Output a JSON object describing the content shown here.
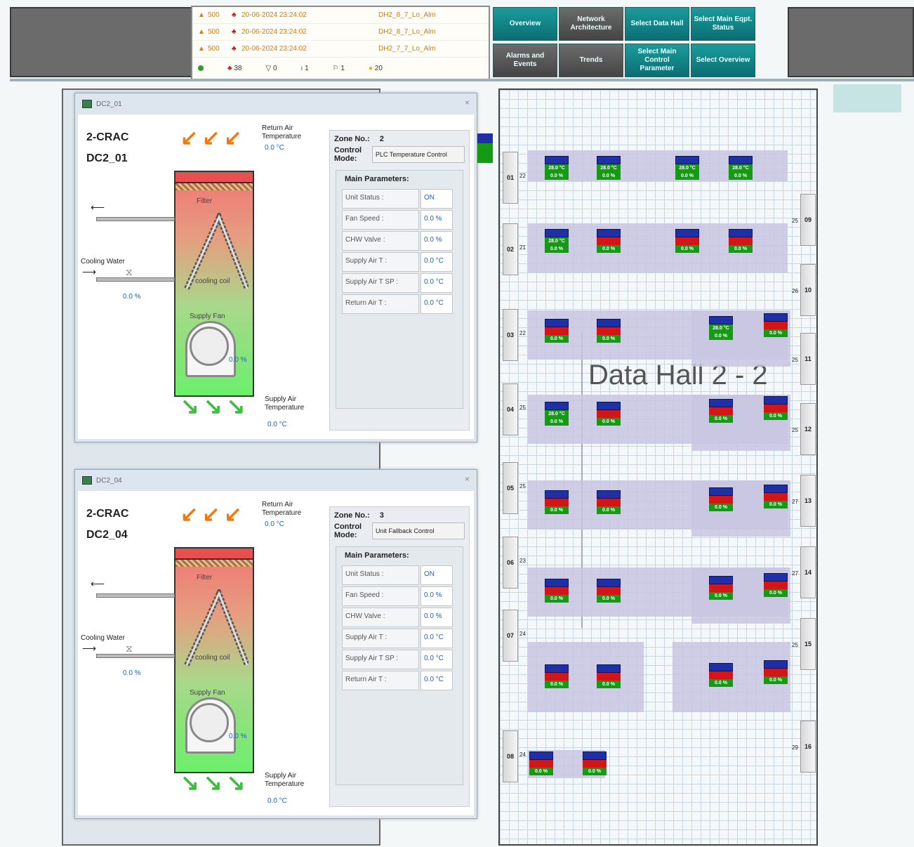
{
  "alarms": {
    "rows": [
      {
        "priority": "500",
        "timestamp": "20-06-2024 23:24:02",
        "tag": "DH2_8_7_Lo_Alm"
      },
      {
        "priority": "500",
        "timestamp": "20-06-2024 23:24:02",
        "tag": "DH2_8_7_Lo_Alm"
      },
      {
        "priority": "500",
        "timestamp": "20-06-2024 23:24:02",
        "tag": "DH2_7_7_Lo_Alm"
      }
    ],
    "summary": [
      "38",
      "0",
      "1",
      "1",
      "20"
    ]
  },
  "nav": {
    "overview": "Overview",
    "network": "Network Architecture",
    "select_data_hall": "Select Data Hall",
    "select_main_eqpt": "Select Main Eqpt. Status",
    "alarms_events": "Alarms and Events",
    "trends": "Trends",
    "select_main_control": "Select Main Control Parameter",
    "select_overview": "Select Overview"
  },
  "crac_windows": [
    {
      "window_title": "DC2_01",
      "name_line1": "2-CRAC",
      "name_line2": "DC2_01",
      "return_air_label": "Return Air Temperature",
      "return_air_value": "0.0 °C",
      "filter_label": "Filter",
      "coil_label": "cooling coil",
      "fan_label": "Supply Fan",
      "fan_value": "0.0 %",
      "cooling_water_label": "Cooling Water",
      "cooling_water_value": "0.0 %",
      "supply_air_label": "Supply Air Temperature",
      "supply_air_value": "0.0 °C",
      "zone_label": "Zone No.:",
      "zone_value": "2",
      "control_mode_label": "Control Mode:",
      "control_mode_value": "PLC Temperature Control",
      "main_params_title": "Main Parameters:",
      "params": [
        {
          "label": "Unit Status :",
          "value": "ON"
        },
        {
          "label": "Fan Speed :",
          "value": "0.0 %"
        },
        {
          "label": "CHW Valve :",
          "value": "0.0 %"
        },
        {
          "label": "Supply Air T :",
          "value": "0.0 °C"
        },
        {
          "label": "Supply Air T SP :",
          "value": "0.0 °C"
        },
        {
          "label": "Return Air T :",
          "value": "0.0 °C"
        }
      ]
    },
    {
      "window_title": "DC2_04",
      "name_line1": "2-CRAC",
      "name_line2": "DC2_04",
      "return_air_label": "Return Air Temperature",
      "return_air_value": "0.0 °C",
      "filter_label": "Filter",
      "coil_label": "cooling coil",
      "fan_label": "Supply Fan",
      "fan_value": "0.0 %",
      "cooling_water_label": "Cooling Water",
      "cooling_water_value": "0.0 %",
      "supply_air_label": "Supply Air Temperature",
      "supply_air_value": "0.0 °C",
      "zone_label": "Zone No.:",
      "zone_value": "3",
      "control_mode_label": "Control Mode:",
      "control_mode_value": "Unit Fallback Control",
      "main_params_title": "Main Parameters:",
      "params": [
        {
          "label": "Unit Status :",
          "value": "ON"
        },
        {
          "label": "Fan Speed :",
          "value": "0.0 %"
        },
        {
          "label": "CHW Valve :",
          "value": "0.0 %"
        },
        {
          "label": "Supply Air T :",
          "value": "0.0 °C"
        },
        {
          "label": "Supply Air T SP :",
          "value": "0.0 °C"
        },
        {
          "label": "Return Air T :",
          "value": "0.0 °C"
        }
      ]
    }
  ],
  "hall": {
    "title": "Data Hall 2 - 2",
    "left_rows": [
      {
        "row": "01",
        "num": "22"
      },
      {
        "row": "02",
        "num": "21"
      },
      {
        "row": "03",
        "num": "22"
      },
      {
        "row": "04",
        "num": "25"
      },
      {
        "row": "05",
        "num": "25"
      },
      {
        "row": "06",
        "num": "23"
      },
      {
        "row": "07",
        "num": "24"
      },
      {
        "row": "08",
        "num": "24"
      }
    ],
    "right_rows": [
      {
        "row": "09",
        "num": "25"
      },
      {
        "row": "10",
        "num": "26"
      },
      {
        "row": "11",
        "num": "25"
      },
      {
        "row": "12",
        "num": "25"
      },
      {
        "row": "13",
        "num": "27"
      },
      {
        "row": "14",
        "num": "27"
      },
      {
        "row": "15",
        "num": "25"
      },
      {
        "row": "16",
        "num": "29"
      }
    ],
    "rack_temp": "28.0 °C",
    "rack_pct": "0.0 %"
  },
  "colors": {
    "alarm_orange": "#e07a00",
    "nav_teal": "#1a9c9c",
    "rack_blue": "#1f2fa6",
    "rack_red": "#d01616",
    "rack_green": "#169a16"
  }
}
